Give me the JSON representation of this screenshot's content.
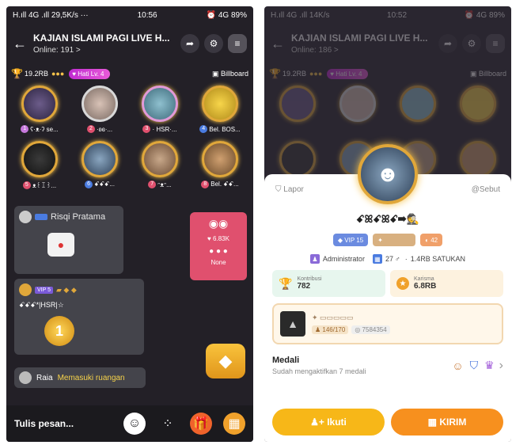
{
  "left": {
    "status": {
      "carrier": "H.ıll 4G .ıll",
      "speed": "29,5K/s",
      "dots": "···",
      "time": "10:56",
      "right": "⏰ 4G 89%"
    },
    "header": {
      "title": "KAJIAN ISLAMI PAGI LIVE H...",
      "online": "Online: 191 >"
    },
    "stats": {
      "score": "19.2RB",
      "heart_level": "Hati Lv. 4",
      "billboard": "Billboard"
    },
    "seats": [
      {
        "num": "1",
        "label": "ʕ·ᴥ·ʔ se...",
        "color": "#c678dd"
      },
      {
        "num": "2",
        "label": "·ʚɞ·...",
        "color": "#e0506e"
      },
      {
        "num": "3",
        "label": "· HSR·...",
        "color": "#e0506e"
      },
      {
        "num": "4",
        "label": "Bel. BOS...",
        "color": "#4a7be0"
      },
      {
        "num": "5",
        "label": "ᴥ꒰ꀤ꒱...",
        "color": "#e0506e"
      },
      {
        "num": "6",
        "label": "ꗃꗃꗃ...",
        "color": "#4a7be0"
      },
      {
        "num": "7",
        "label": "ᵔᴥᵔ...",
        "color": "#e0506e"
      },
      {
        "num": "8",
        "label": "Bel. ꗃꗃ...",
        "color": "#e0506e"
      }
    ],
    "chat": {
      "msg1_name": "Risqi Pratama",
      "msg2_badge": "VIP 5",
      "msg2_name": "ꗃꗃꗃ*|HSR|☆",
      "entry_name": "Raia",
      "entry_text": "Memasuki ruangan"
    },
    "pk": {
      "value": "6.83K",
      "status": "None"
    },
    "bottom": {
      "placeholder": "Tulis pesan..."
    }
  },
  "right": {
    "status": {
      "carrier": "H.ıll 4G .ıll",
      "speed": "14K/s",
      "time": "10:52",
      "right": "⏰ 4G 89%"
    },
    "header": {
      "title": "KAJIAN ISLAMI PAGI LIVE H...",
      "online": "Online: 186 >"
    },
    "stats": {
      "score": "19.2RB",
      "heart_level": "Hati Lv. 4",
      "billboard": "Billboard"
    },
    "profile": {
      "report": "Lapor",
      "mention": "@Sebut",
      "name": "ꗃꕤꗃꕤꗃ➡🕵",
      "vip": "VIP 15",
      "level": "42",
      "role": "Administrator",
      "age": "27",
      "followers": "1.4RB SATUKAN",
      "contribution_label": "Kontribusi",
      "contribution_value": "782",
      "charisma_label": "Karisma",
      "charisma_value": "6.8RB",
      "family_members": "146/170",
      "family_id": "7584354",
      "medal_title": "Medali",
      "medal_sub": "Sudah mengaktifkan 7 medali",
      "follow": "Ikuti",
      "send": "KIRIM"
    }
  }
}
